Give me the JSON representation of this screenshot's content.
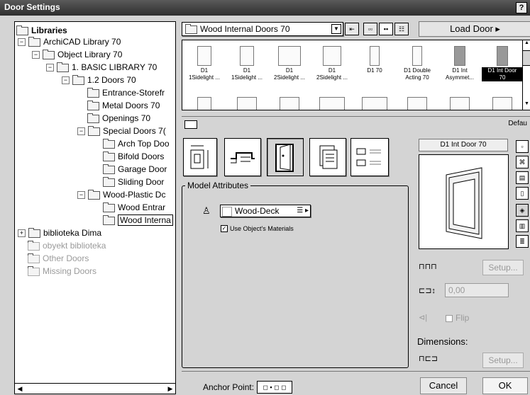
{
  "window": {
    "title": "Door Settings",
    "help": "?"
  },
  "tree": {
    "root": "Libraries",
    "items": [
      {
        "label": "ArchiCAD Library 70"
      },
      {
        "label": "Object Library 70"
      },
      {
        "label": "1. BASIC LIBRARY 70"
      },
      {
        "label": "1.2 Doors 70"
      },
      {
        "label": "Entrance-Storefr"
      },
      {
        "label": "Metal Doors 70"
      },
      {
        "label": "Openings 70"
      },
      {
        "label": "Special Doors 7("
      },
      {
        "label": "Arch Top Doo"
      },
      {
        "label": "Bifold Doors"
      },
      {
        "label": "Garage Door"
      },
      {
        "label": "Sliding Door"
      },
      {
        "label": "Wood-Plastic Dc"
      },
      {
        "label": "Wood Entrar"
      },
      {
        "label": "Wood Interna"
      },
      {
        "label": "biblioteka Dima"
      },
      {
        "label": "obyekt biblioteka"
      },
      {
        "label": "Other Doors"
      },
      {
        "label": "Missing Doors"
      }
    ]
  },
  "library_select": {
    "value": "Wood Internal Doors 70"
  },
  "load_button": "Load Door",
  "thumbs": [
    {
      "line1": "D1",
      "line2": "1Sidelight ..."
    },
    {
      "line1": "D1",
      "line2": "1Sidelight ..."
    },
    {
      "line1": "D1",
      "line2": "2Sidelight ..."
    },
    {
      "line1": "D1",
      "line2": "2Sidelight ..."
    },
    {
      "line1": "D1 70",
      "line2": ""
    },
    {
      "line1": "D1 Double",
      "line2": "Acting 70"
    },
    {
      "line1": "D1 Int",
      "line2": "Asymmet..."
    },
    {
      "line1": "D1 Int Door",
      "line2": "70"
    }
  ],
  "defaults_label": "Defau",
  "model_attributes": {
    "legend": "Model Attributes",
    "material": "Wood-Deck",
    "use_materials": "Use Object's Materials"
  },
  "preview": {
    "name": "D1 Int Door 70"
  },
  "setup1": "Setup...",
  "offset_value": "0,00",
  "flip": "Flip",
  "dimensions": "Dimensions:",
  "setup2": "Setup...",
  "anchor": "Anchor Point:",
  "cancel": "Cancel",
  "ok": "OK"
}
